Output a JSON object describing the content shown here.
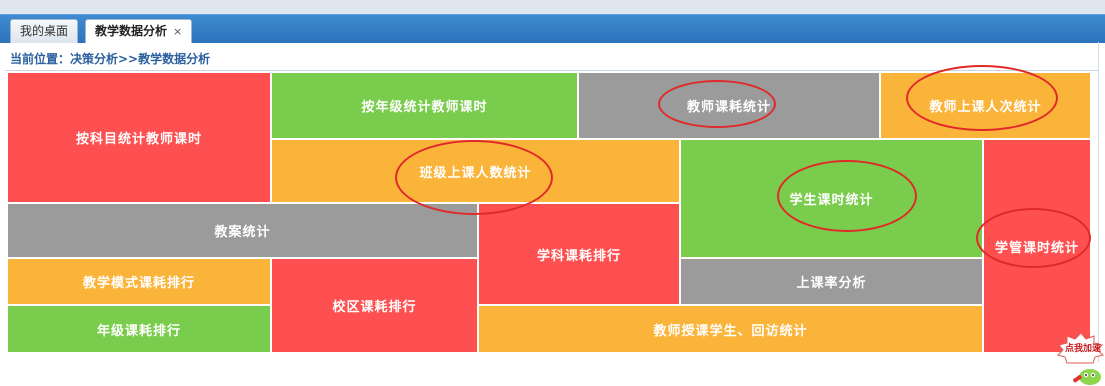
{
  "tabs": [
    {
      "label": "我的桌面"
    },
    {
      "label": "教学数据分析",
      "close": "×"
    }
  ],
  "breadcrumb": "当前位置：决策分析>>教学数据分析",
  "tiles": [
    {
      "label": "按科目统计教师课时",
      "color": "#fe5050"
    },
    {
      "label": "按年级统计教师课时",
      "color": "#7acc4c"
    },
    {
      "label": "教师课耗统计",
      "color": "#9b9b9b"
    },
    {
      "label": "教师上课人次统计",
      "color": "#fbb43a"
    },
    {
      "label": "班级上课人数统计",
      "color": "#fbb43a"
    },
    {
      "label": "学生课时统计",
      "color": "#7acc4c"
    },
    {
      "label": "学管课时统计",
      "color": "#fe5050"
    },
    {
      "label": "教案统计",
      "color": "#9b9b9b"
    },
    {
      "label": "学科课耗排行",
      "color": "#fe5050"
    },
    {
      "label": "上课率分析",
      "color": "#9b9b9b"
    },
    {
      "label": "教学模式课耗排行",
      "color": "#fbb43a"
    },
    {
      "label": "校区课耗排行",
      "color": "#fe5050"
    },
    {
      "label": "年级课耗排行",
      "color": "#7acc4c"
    },
    {
      "label": "教师授课学生、回访统计",
      "color": "#fbb43a"
    }
  ],
  "speed_badge": {
    "label": "点我加速",
    "icon": "rocket-icon"
  }
}
